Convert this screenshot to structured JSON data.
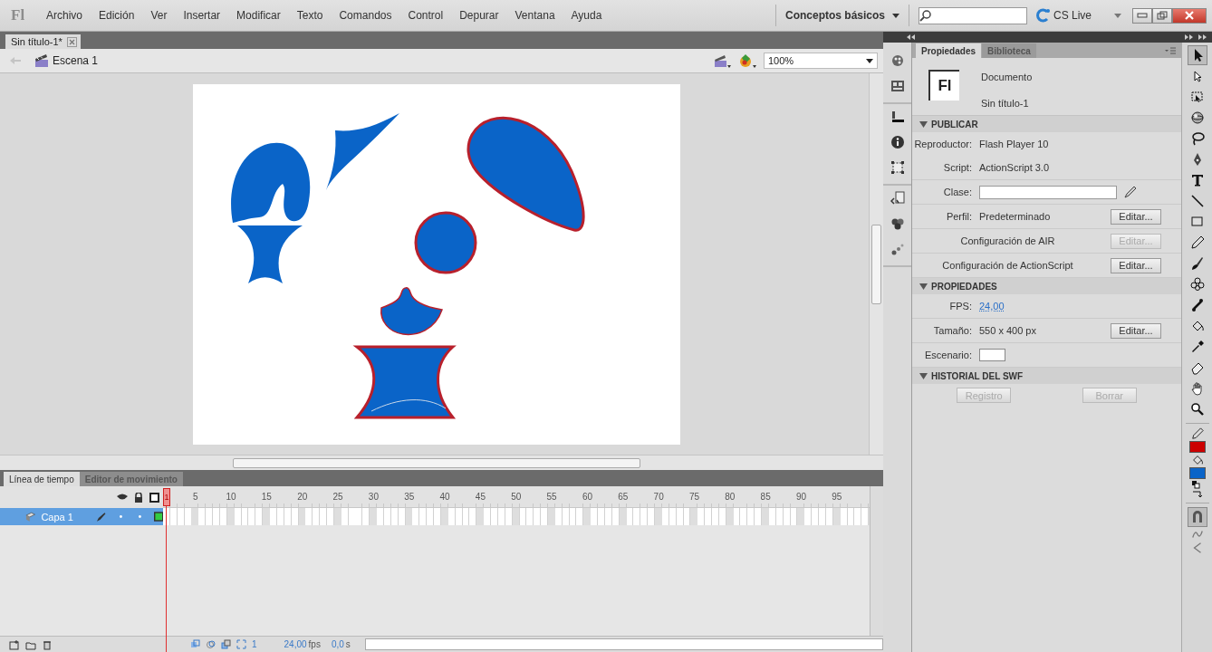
{
  "app_logo": "Fl",
  "menu": [
    "Archivo",
    "Edición",
    "Ver",
    "Insertar",
    "Modificar",
    "Texto",
    "Comandos",
    "Control",
    "Depurar",
    "Ventana",
    "Ayuda"
  ],
  "workspace": {
    "label": "Conceptos básicos"
  },
  "cs_live": {
    "label": "CS Live"
  },
  "document_tabs": [
    {
      "label": "Sin título-1*",
      "selected": true
    }
  ],
  "edit_bar": {
    "scene": "Escena 1",
    "zoom": "100%"
  },
  "timeline": {
    "tabs": [
      {
        "label": "Línea de tiempo",
        "selected": true
      },
      {
        "label": "Editor de movimiento",
        "selected": false
      }
    ],
    "playhead": "1",
    "frame_numbers": [
      "5",
      "10",
      "15",
      "20",
      "25",
      "30",
      "35",
      "40",
      "45",
      "50",
      "55",
      "60",
      "65",
      "70",
      "75",
      "80",
      "85",
      "90",
      "95"
    ],
    "layers": [
      {
        "name": "Capa 1",
        "selected": true,
        "color": "#33cc44"
      }
    ],
    "status": {
      "current_frame": "1",
      "fps_value": "24,00",
      "fps_unit": "fps",
      "time_value": "0,0",
      "time_unit": "s"
    }
  },
  "properties": {
    "tabs": [
      {
        "label": "Propiedades",
        "selected": true
      },
      {
        "label": "Biblioteca",
        "selected": false
      }
    ],
    "document": {
      "icon": "Fl",
      "type": "Documento",
      "name": "Sin título-1"
    },
    "sections": [
      {
        "title": "PUBLICAR",
        "expanded": true,
        "rows": [
          {
            "kind": "text",
            "label": "Reproductor:",
            "value": "Flash Player 10"
          },
          {
            "kind": "text",
            "label": "Script:",
            "value": "ActionScript 3.0"
          },
          {
            "kind": "field",
            "label": "Clase:"
          },
          {
            "kind": "button",
            "label": "Perfil:",
            "value": "Predeterminado",
            "button": {
              "label": "Editar...",
              "disabled": false
            }
          },
          {
            "kind": "button",
            "label": "Configuración de AIR",
            "button": {
              "label": "Editar...",
              "disabled": true
            }
          },
          {
            "kind": "button",
            "label": "Configuración de ActionScript",
            "button": {
              "label": "Editar...",
              "disabled": false
            }
          }
        ]
      },
      {
        "title": "PROPIEDADES",
        "expanded": true,
        "rows": [
          {
            "kind": "link",
            "label": "FPS:",
            "value": "24,00"
          },
          {
            "kind": "button",
            "label": "Tamaño:",
            "value": "550 x 400 px",
            "button": {
              "label": "Editar...",
              "disabled": false
            }
          },
          {
            "kind": "swatch",
            "label": "Escenario:"
          }
        ]
      },
      {
        "title": "HISTORIAL DEL SWF",
        "expanded": true,
        "rows": [
          {
            "kind": "buttons",
            "buttons": [
              {
                "label": "Registro",
                "disabled": true
              },
              {
                "label": "Borrar",
                "disabled": true
              }
            ]
          }
        ]
      }
    ]
  },
  "tools": [
    {
      "kind": "selection",
      "selected": true
    },
    {
      "kind": "subselection",
      "selected": false
    },
    {
      "kind": "free-transform",
      "selected": false
    },
    {
      "kind": "rotation-3d",
      "selected": false
    },
    {
      "kind": "lasso",
      "selected": false
    },
    {
      "kind": "pen",
      "selected": false
    },
    {
      "kind": "text",
      "selected": false
    },
    {
      "kind": "line",
      "selected": false
    },
    {
      "kind": "rectangle",
      "selected": false
    },
    {
      "kind": "pencil",
      "selected": false
    },
    {
      "kind": "brush",
      "selected": false
    },
    {
      "kind": "deco",
      "selected": false
    },
    {
      "kind": "bone",
      "selected": false
    },
    {
      "kind": "paint-bucket",
      "selected": false
    },
    {
      "kind": "eyedropper",
      "selected": false
    },
    {
      "kind": "eraser",
      "selected": false
    },
    {
      "kind": "hand",
      "selected": false
    },
    {
      "kind": "zoom",
      "selected": false
    }
  ],
  "color_swatches": [
    {
      "kind": "stroke",
      "color": "#cc0000"
    },
    {
      "kind": "fill",
      "color": "#0a64c8"
    }
  ]
}
